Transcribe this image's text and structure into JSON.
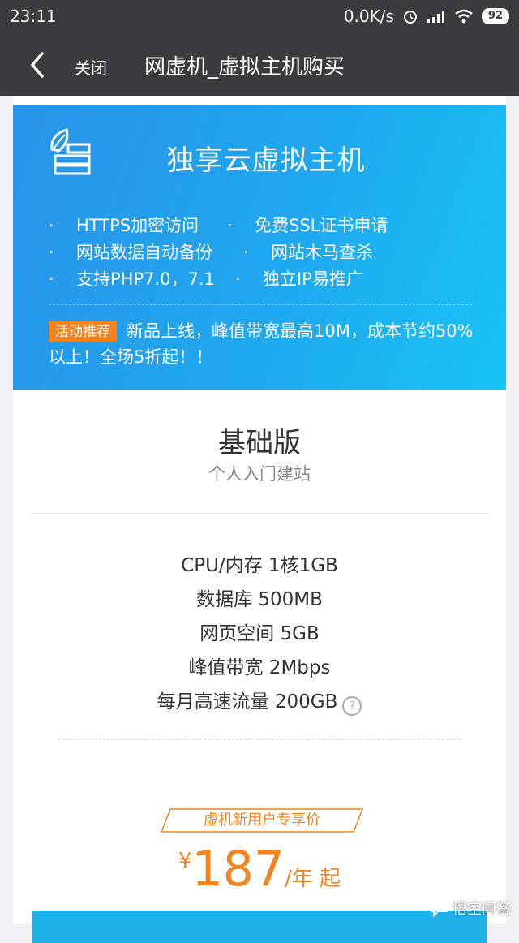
{
  "status_bar": {
    "time": "23:11",
    "network_speed": "0.0K/s",
    "battery": "92"
  },
  "app_bar": {
    "close_label": "关闭",
    "title": "网虚机_虚拟主机购买"
  },
  "banner": {
    "title": "独享云虚拟主机",
    "bullet": "·",
    "features": [
      "HTTPS加密访问",
      "免费SSL证书申请",
      "网站数据自动备份",
      "网站木马查杀",
      "支持PHP7.0，7.1",
      "独立IP易推广"
    ],
    "promo_tag": "活动推荐",
    "promo_text": "新品上线，峰值带宽最高10M，成本节约50%以上！全场5折起！！"
  },
  "plan": {
    "name": "基础版",
    "subtitle": "个人入门建站",
    "specs": [
      "CPU/内存 1核1GB",
      "数据库 500MB",
      "网页空间 5GB",
      "峰值带宽 2Mbps",
      "每月高速流量 200GB"
    ],
    "price_label": "虚机新用户专享价",
    "currency": "¥",
    "price": "187",
    "unit": "/年 起"
  },
  "watermark": "悟空问答",
  "colors": {
    "dark_bar": "#3a3b3f",
    "banner_blue": "#1fa8ef",
    "accent_orange": "#f5831f"
  }
}
